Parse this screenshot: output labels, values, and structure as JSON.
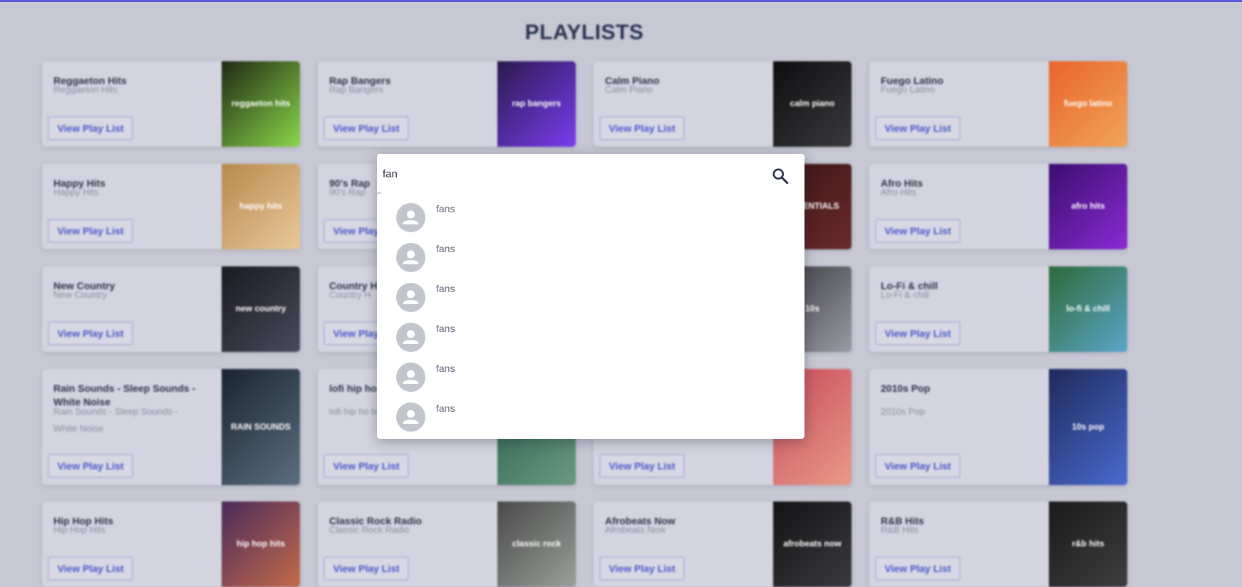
{
  "page": {
    "title": "PLAYLISTS"
  },
  "button_label": "View Play List",
  "playlists": [
    {
      "name": "Reggaeton Hits",
      "subtitle": "Reggaeton Hits",
      "cover_text": "reggaeton hits"
    },
    {
      "name": "Rap Bangers",
      "subtitle": "Rap Bangers",
      "cover_text": "rap bangers"
    },
    {
      "name": "Calm Piano",
      "subtitle": "Calm Piano",
      "cover_text": "calm piano"
    },
    {
      "name": "Fuego Latino",
      "subtitle": "Fuego Latino",
      "cover_text": "fuego latino"
    },
    {
      "name": "Happy Hits",
      "subtitle": "Happy Hits",
      "cover_text": "happy hits"
    },
    {
      "name": "90's Rap",
      "subtitle": "90's Rap",
      "cover_text": ""
    },
    {
      "name": "",
      "subtitle": "",
      "cover_text": "ESSENTIALS"
    },
    {
      "name": "Afro Hits",
      "subtitle": "Afro Hits",
      "cover_text": "afro hits"
    },
    {
      "name": "New Country",
      "subtitle": "New Country",
      "cover_text": "new country"
    },
    {
      "name": "Country H",
      "subtitle": "Country H",
      "cover_text": ""
    },
    {
      "name": "",
      "subtitle": "",
      "cover_text": "10s"
    },
    {
      "name": "Lo-Fi & chill",
      "subtitle": "Lo-Fi & chill",
      "cover_text": "lo-fi & chill"
    },
    {
      "name": "Rain Sounds - Sleep Sounds - White Noise",
      "subtitle": "Rain Sounds - Sleep Sounds - White Noise",
      "cover_text": "RAIN SOUNDS"
    },
    {
      "name": "lofi hip ho by Lofi Gi",
      "subtitle": "lofi hip ho by Lofi Gi",
      "cover_text": ""
    },
    {
      "name": "",
      "subtitle": "",
      "cover_text": ""
    },
    {
      "name": "2010s Pop",
      "subtitle": "2010s Pop",
      "cover_text": "10s pop"
    },
    {
      "name": "Hip Hop Hits",
      "subtitle": "Hip Hop Hits",
      "cover_text": "hip hop hits"
    },
    {
      "name": "Classic Rock Radio",
      "subtitle": "Classic Rock Radio",
      "cover_text": "classic rock"
    },
    {
      "name": "Afrobeats Now",
      "subtitle": "Afrobeats Now",
      "cover_text": "afrobeats now"
    },
    {
      "name": "R&B Hits",
      "subtitle": "R&B Hits",
      "cover_text": "r&b hits"
    }
  ],
  "search": {
    "value": "fan",
    "results": [
      {
        "label": "fans"
      },
      {
        "label": "fans"
      },
      {
        "label": "fans"
      },
      {
        "label": "fans"
      },
      {
        "label": "fans"
      },
      {
        "label": "fans"
      }
    ]
  },
  "icons": {
    "search": "search-icon",
    "avatar": "person-icon"
  },
  "colors": {
    "accent": "#4a57c8",
    "top_bar": "#5b5bd6",
    "backdrop": "#c7c8d4"
  }
}
